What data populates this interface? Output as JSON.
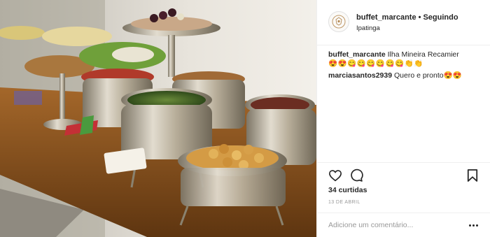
{
  "post": {
    "username": "buffet_marcante",
    "separator": "•",
    "follow_status": "Seguindo",
    "location": "Ipatinga",
    "image_alt": "Buffet com travessas de prata"
  },
  "comments": [
    {
      "username": "buffet_marcante",
      "text": "Ilha Mineira Recamier",
      "emoji_line": "😍😍😋😋😋😋😋😋👏👏"
    },
    {
      "username": "marciasantos2939",
      "text": "Quero e pronto😍😍"
    }
  ],
  "actions": {
    "likes_text": "34 curtidas",
    "date_text": "13 DE ABRIL"
  },
  "add_comment": {
    "placeholder": "Adicione um comentário..."
  },
  "icons": {
    "like": "heart-icon",
    "comment": "comment-bubble-icon",
    "save": "bookmark-icon",
    "more": "more-options-icon"
  }
}
